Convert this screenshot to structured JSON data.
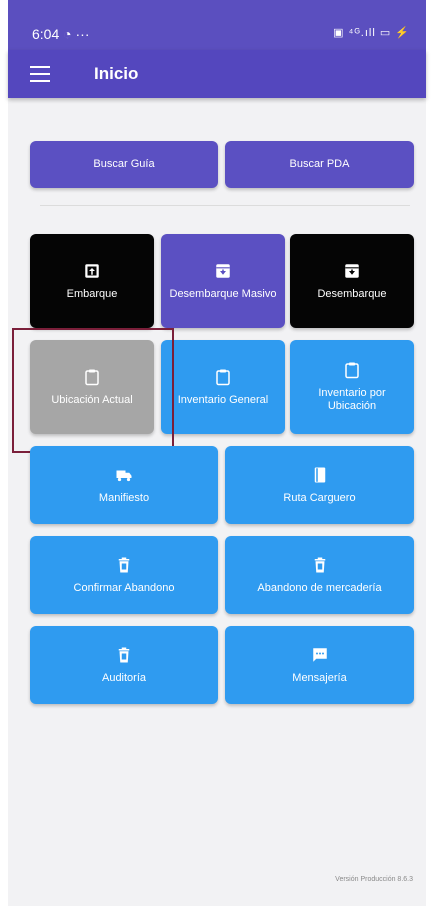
{
  "statusbar": {
    "time": "6:04",
    "extras": "···",
    "right_icons": "▣ ⁴ᴳ.ıll ▭ ⚡"
  },
  "appbar": {
    "title": "Inicio"
  },
  "search": {
    "buscar_guia": "Buscar Guía",
    "buscar_pda": "Buscar PDA"
  },
  "tiles": {
    "embarque": "Embarque",
    "desembarque_masivo": "Desembarque Masivo",
    "desembarque": "Desembarque",
    "ubicacion_actual": "Ubicación Actual",
    "inventario_general": "Inventario General",
    "inventario_por_ubicacion": "Inventario por Ubicación",
    "manifiesto": "Manifiesto",
    "ruta_carguero": "Ruta Carguero",
    "confirmar_abandono": "Confirmar Abandono",
    "abandono_mercaderia": "Abandono de mercadería",
    "auditoria": "Auditoría",
    "mensajeria": "Mensajería"
  },
  "footer": {
    "version": "Versión Producción 8.6.3"
  },
  "colors": {
    "appbar": "#5447be",
    "purple": "#5b50c2",
    "black": "#050505",
    "blue": "#2f9bf0",
    "gray": "#a6a6a6",
    "highlight": "#7b1f3a"
  },
  "icons": {
    "embarque": "upload-box-icon",
    "desembarque_masivo": "archive-down-icon",
    "desembarque": "archive-down-icon",
    "clipboard": "clipboard-icon",
    "manifiesto": "truck-icon",
    "ruta_carguero": "book-icon",
    "trash": "trash-icon",
    "mensajeria": "message-icon"
  }
}
